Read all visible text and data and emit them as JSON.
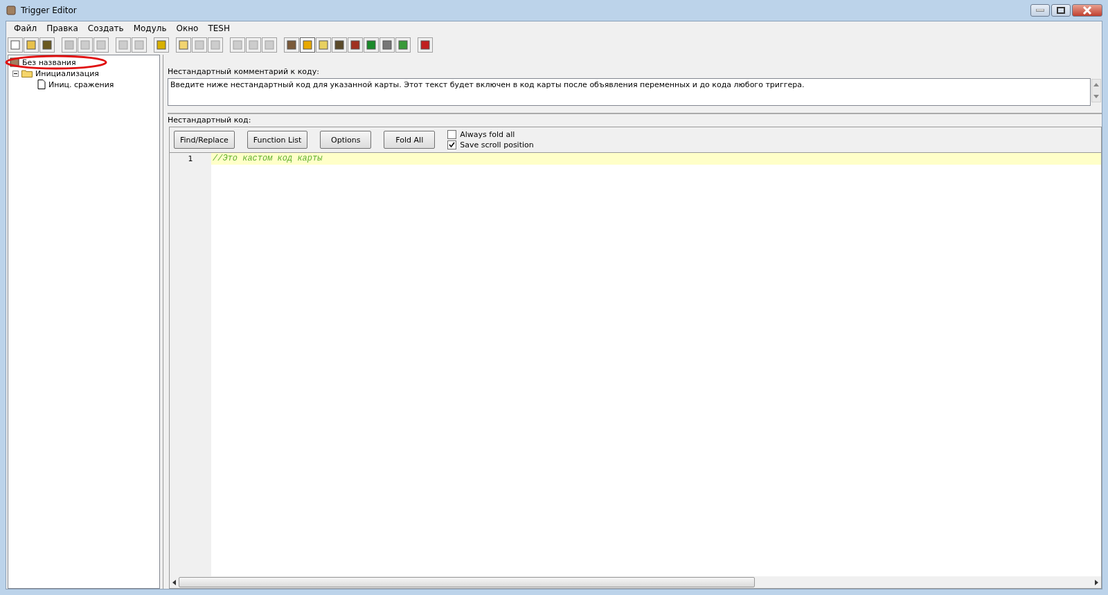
{
  "window": {
    "title": "Trigger Editor"
  },
  "menu": [
    "Файл",
    "Правка",
    "Создать",
    "Модуль",
    "Окно",
    "TESH"
  ],
  "tree": {
    "label": "Без названия",
    "children": [
      {
        "label": "Инициализация",
        "expanded": true,
        "children": [
          {
            "label": "Иниц. сражения"
          }
        ]
      }
    ]
  },
  "comment": {
    "label": "Нестандартный комментарий к коду:",
    "value": "Введите ниже нестандартный код для указанной карты. Этот текст будет включен в код карты после объявления переменных и до кода любого триггера."
  },
  "code": {
    "label": "Нестандартный код:",
    "buttons": [
      "Find/Replace",
      "Function List",
      "Options",
      "Fold All"
    ],
    "options": [
      {
        "label": "Always fold all",
        "checked": false
      },
      {
        "label": "Save scroll position",
        "checked": true
      }
    ],
    "lines": [
      {
        "number": "1",
        "text": "//Это кастом код карты"
      }
    ]
  }
}
